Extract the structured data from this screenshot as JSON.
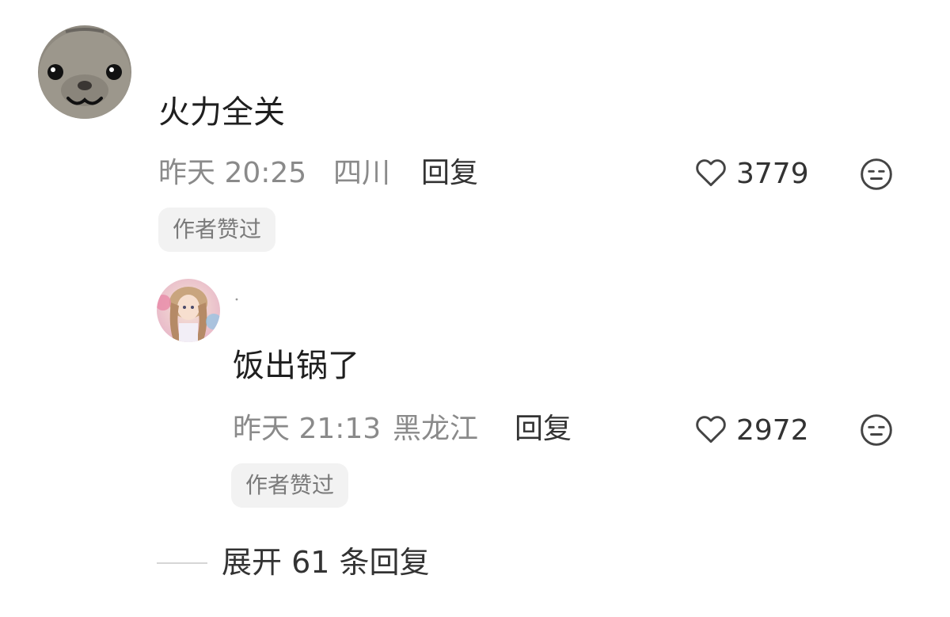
{
  "comment": {
    "text": "火力全关",
    "date": "昨天 20:25",
    "location": "四川",
    "reply_label": "回复",
    "like_count": "3779",
    "badge": "作者赞过"
  },
  "reply": {
    "text": "饭出锅了",
    "date": "昨天 21:13",
    "location": "黑龙江",
    "reply_label": "回复",
    "like_count": "2972",
    "badge": "作者赞过"
  },
  "expand": {
    "label": "展开 61 条回复"
  },
  "icons": {
    "like": "heart-outline-icon",
    "dislike": "neutral-face-icon"
  },
  "colors": {
    "meta_text": "#8a8a8a",
    "badge_bg": "#f2f2f2",
    "primary_text": "#1f1f1f"
  }
}
